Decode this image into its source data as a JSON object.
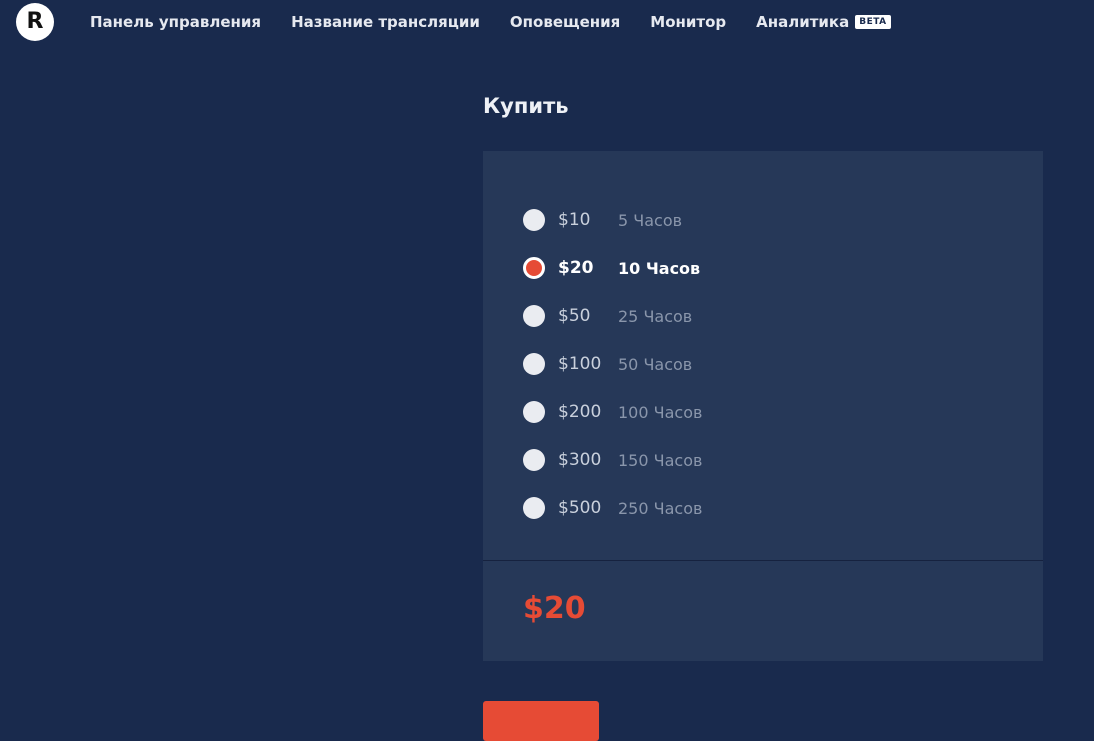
{
  "header": {
    "logo_letter": "R",
    "nav": [
      {
        "label": "Панель управления"
      },
      {
        "label": "Название трансляции"
      },
      {
        "label": "Оповещения"
      },
      {
        "label": "Монитор"
      },
      {
        "label": "Аналитика",
        "badge": "BETA"
      }
    ]
  },
  "purchase": {
    "title": "Купить",
    "options": [
      {
        "price": "$10",
        "hours": "5 Часов",
        "selected": false
      },
      {
        "price": "$20",
        "hours": "10 Часов",
        "selected": true
      },
      {
        "price": "$50",
        "hours": "25 Часов",
        "selected": false
      },
      {
        "price": "$100",
        "hours": "50 Часов",
        "selected": false
      },
      {
        "price": "$200",
        "hours": "100 Часов",
        "selected": false
      },
      {
        "price": "$300",
        "hours": "150 Часов",
        "selected": false
      },
      {
        "price": "$500",
        "hours": "250 Часов",
        "selected": false
      }
    ],
    "total": "$20"
  },
  "colors": {
    "background": "#192a4d",
    "panel": "#263858",
    "accent": "#e64b35"
  }
}
